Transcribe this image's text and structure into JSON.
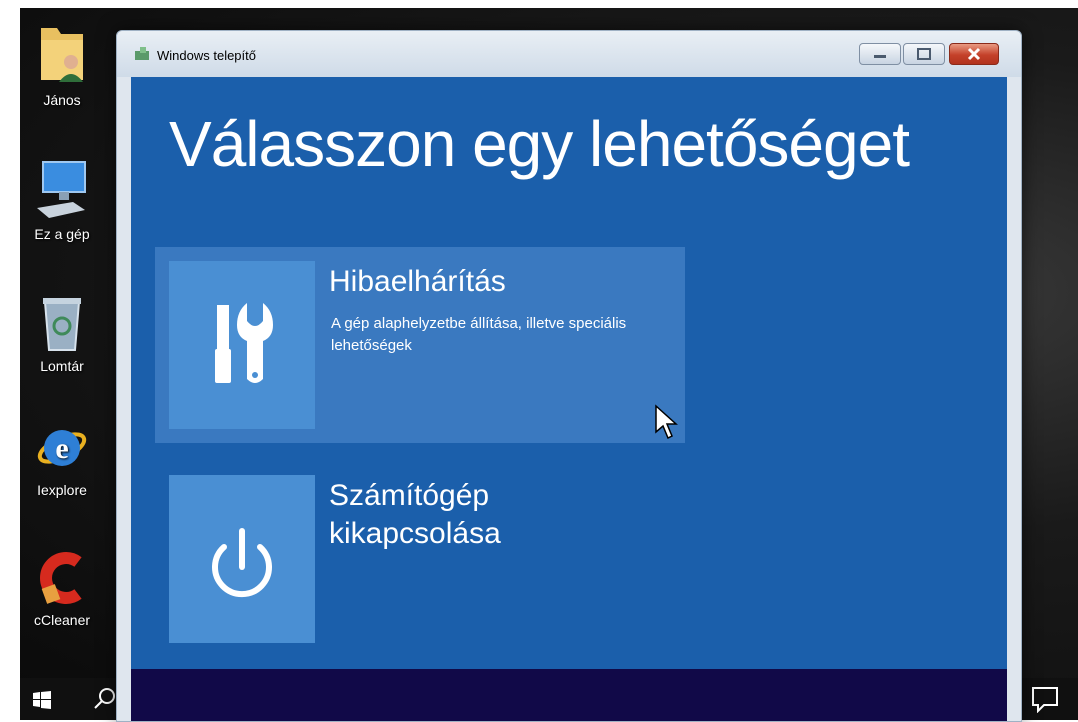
{
  "desktop": {
    "icons": [
      {
        "label": "János",
        "icon": "user-folder-icon"
      },
      {
        "label": "Ez a gép",
        "icon": "computer-icon"
      },
      {
        "label": "Lomtár",
        "icon": "recycle-bin-icon"
      },
      {
        "label": "Iexplore",
        "icon": "internet-explorer-icon"
      },
      {
        "label": "cCleaner",
        "icon": "ccleaner-icon"
      }
    ]
  },
  "taskbar": {
    "start_icon": "windows-start-icon",
    "search_icon": "search-icon",
    "notification_icon": "action-center-icon"
  },
  "window": {
    "title": "Windows telepítő",
    "heading": "Válasszon egy lehetőséget",
    "options": [
      {
        "title": "Hibaelhárítás",
        "description": "A gép alaphelyzetbe állítása, illetve speciális lehetőségek",
        "icon": "tools-icon"
      },
      {
        "title": "Számítógép kikapcsolása",
        "description": "",
        "icon": "power-icon"
      }
    ]
  },
  "colors": {
    "content_bg": "#1b5fab",
    "tile_bg": "#4a8fd3",
    "hover_bg": "#3a79c0",
    "footer_bg": "#110948"
  }
}
